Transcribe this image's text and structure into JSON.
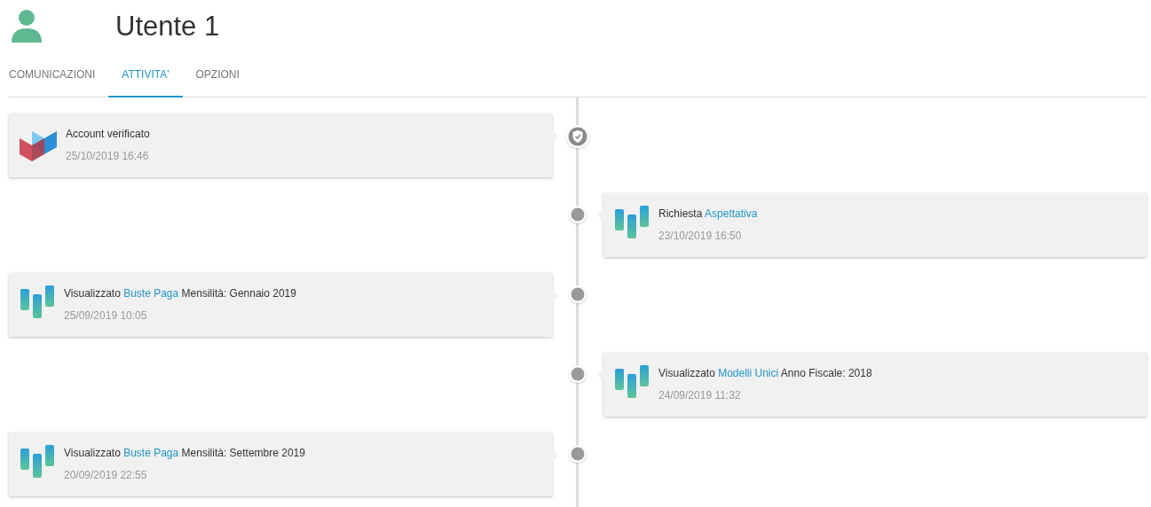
{
  "user": {
    "name": "Utente 1"
  },
  "tabs": [
    {
      "label": "COMUNICAZIONI",
      "selected": false
    },
    {
      "label": "ATTIVITA'",
      "selected": true
    },
    {
      "label": "OPZIONI",
      "selected": false
    }
  ],
  "timeline": [
    {
      "kind": "verification",
      "title": [
        {
          "text": "Account verificato",
          "link": false
        }
      ],
      "time": "25/10/2019 16:46"
    },
    {
      "kind": "activity",
      "title": [
        {
          "text": "Richiesta ",
          "link": false
        },
        {
          "text": "Aspettativa",
          "link": true
        }
      ],
      "time": "23/10/2019 16:50"
    },
    {
      "kind": "activity",
      "title": [
        {
          "text": "Visualizzato ",
          "link": false
        },
        {
          "text": "Buste Paga",
          "link": true
        },
        {
          "text": " Mensilità: Gennaio 2019",
          "link": false
        }
      ],
      "time": "25/09/2019 10:05"
    },
    {
      "kind": "activity",
      "title": [
        {
          "text": "Visualizzato ",
          "link": false
        },
        {
          "text": "Modelli Unici",
          "link": true
        },
        {
          "text": " Anno Fiscale: 2018",
          "link": false
        }
      ],
      "time": "24/09/2019 11:32"
    },
    {
      "kind": "activity",
      "title": [
        {
          "text": "Visualizzato ",
          "link": false
        },
        {
          "text": "Buste Paga",
          "link": true
        },
        {
          "text": " Mensilità: Settembre 2019",
          "link": false
        }
      ],
      "time": "20/09/2019 22:55"
    }
  ]
}
